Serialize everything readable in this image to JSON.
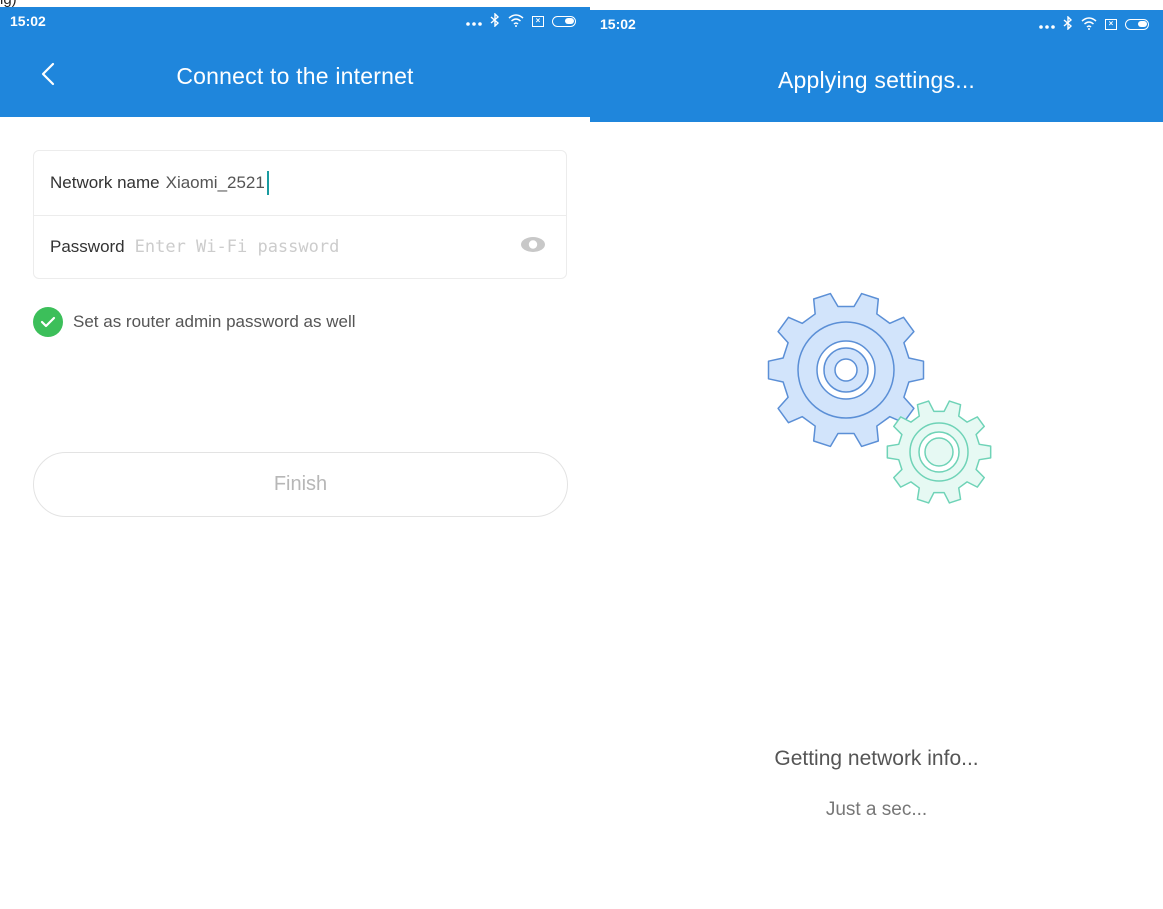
{
  "left": {
    "crop_glyphs": "ig)",
    "status": {
      "time": "15:02",
      "icons": [
        "dots-icon",
        "bluetooth-icon",
        "wifi-icon",
        "sim-icon",
        "battery-icon"
      ]
    },
    "app_bar": {
      "title": "Connect to the internet",
      "back_icon": "chevron-left-icon"
    },
    "form": {
      "network_label": "Network name",
      "network_value": "Xiaomi_2521",
      "password_label": "Password",
      "password_placeholder": "Enter Wi-Fi password",
      "password_value": "",
      "eye_icon": "eye-icon"
    },
    "admin_checkbox": {
      "label": "Set as router admin password as well",
      "checked": true
    },
    "finish_label": "Finish"
  },
  "right": {
    "status": {
      "time": "15:02",
      "icons": [
        "dots-icon",
        "bluetooth-icon",
        "wifi-icon",
        "sim-icon",
        "battery-icon"
      ]
    },
    "app_bar": {
      "title": "Applying settings..."
    },
    "illustration": "gears-icon",
    "progress_main": "Getting network info...",
    "progress_sub": "Just a sec..."
  },
  "colors": {
    "primary_blue": "#1f86dc",
    "check_green": "#3cbf5a",
    "cursor_teal": "#1a9ba0",
    "gear_blue_fill": "#d2e4fb",
    "gear_blue_stroke": "#5b8fd6",
    "gear_green_fill": "#e6f9f3",
    "gear_green_stroke": "#6fd3b7"
  }
}
